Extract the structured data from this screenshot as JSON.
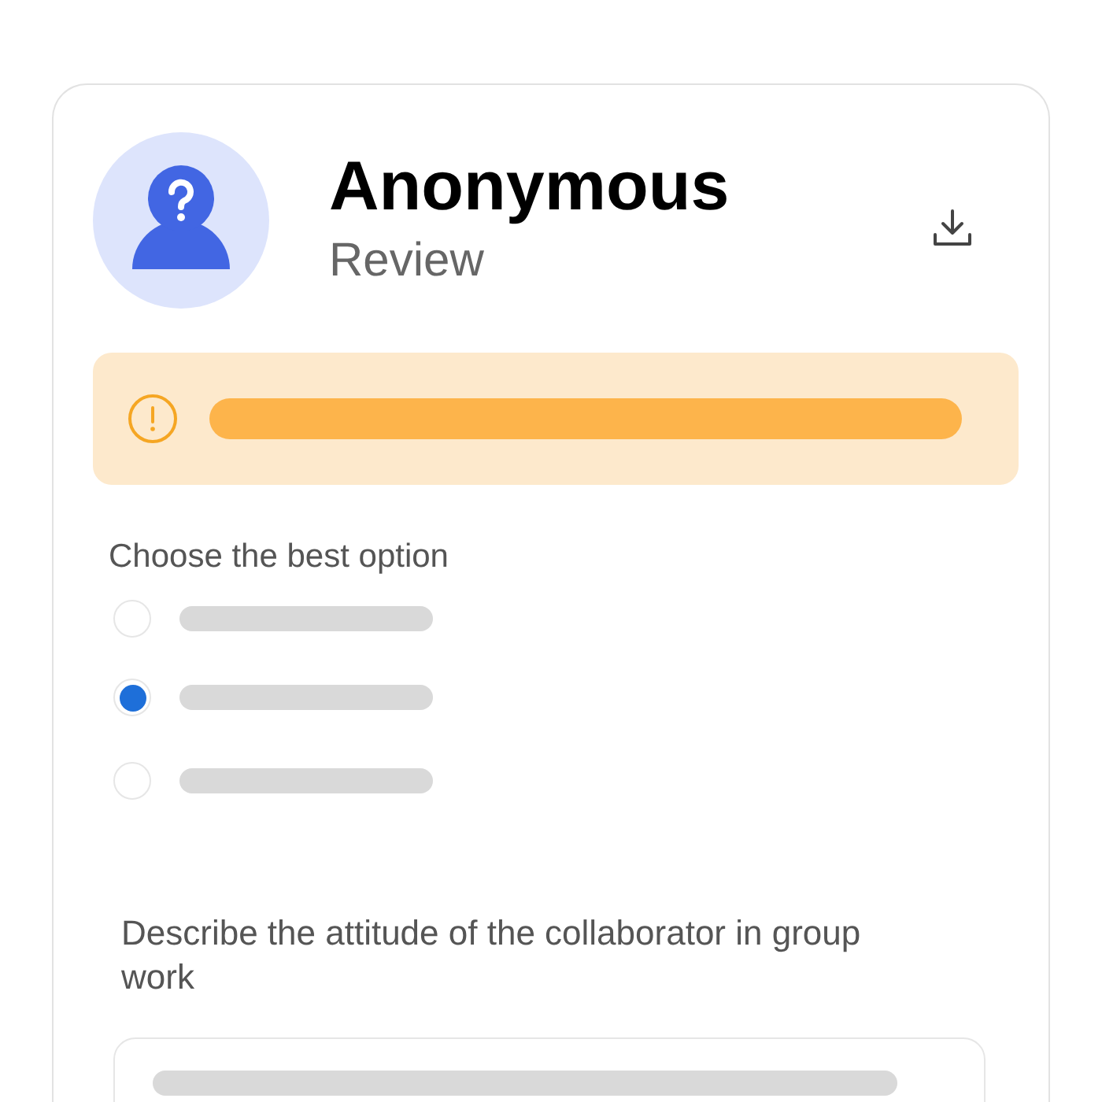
{
  "header": {
    "title": "Anonymous",
    "subtitle": "Review"
  },
  "alert": {
    "kind": "warning"
  },
  "question_1": {
    "label": "Choose the best option",
    "options": [
      {
        "selected": false
      },
      {
        "selected": true
      },
      {
        "selected": false
      }
    ]
  },
  "question_2": {
    "label": "Describe the attitude of the collaborator in group work"
  }
}
